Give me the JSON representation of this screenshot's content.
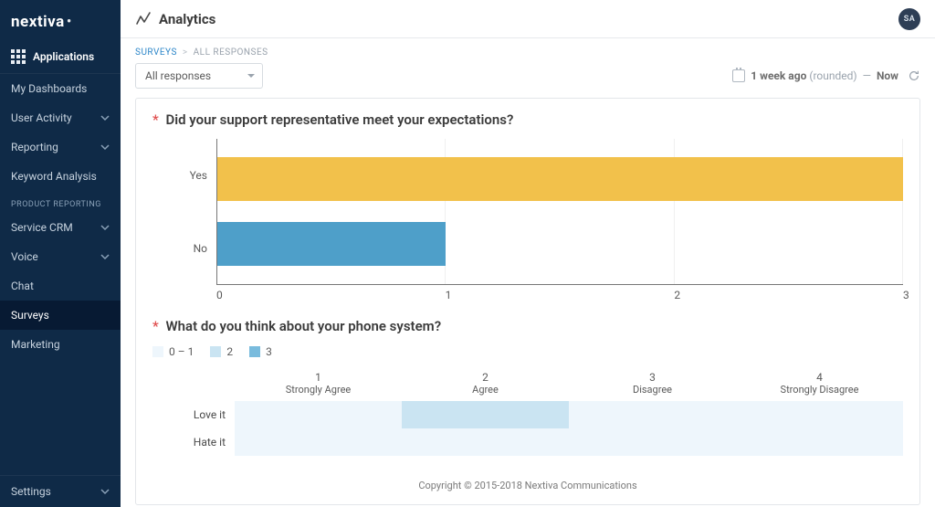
{
  "brand": {
    "name": "nextiva"
  },
  "avatar": {
    "initials": "SA"
  },
  "page": {
    "title": "Analytics",
    "breadcrumb": {
      "root": "SURVEYS",
      "leaf": "ALL RESPONSES"
    }
  },
  "sidebar": {
    "apps_label": "Applications",
    "sections": {
      "top": [
        {
          "label": "My Dashboards",
          "expandable": false
        },
        {
          "label": "User Activity",
          "expandable": true
        },
        {
          "label": "Reporting",
          "expandable": true
        },
        {
          "label": "Keyword Analysis",
          "expandable": false
        }
      ],
      "product_header": "PRODUCT REPORTING",
      "product": [
        {
          "label": "Service CRM",
          "expandable": true
        },
        {
          "label": "Voice",
          "expandable": true
        },
        {
          "label": "Chat",
          "expandable": false
        },
        {
          "label": "Surveys",
          "expandable": false,
          "active": true
        },
        {
          "label": "Marketing",
          "expandable": false
        }
      ]
    },
    "settings_label": "Settings"
  },
  "filters": {
    "dropdown_value": "All responses",
    "range_from": "1 week ago",
    "range_from_suffix": "(rounded)",
    "range_sep": "—",
    "range_to": "Now"
  },
  "questions": [
    {
      "required": true,
      "text": "Did your support representative meet your expectations?",
      "chart": "chart1"
    },
    {
      "required": true,
      "text": "What do you think about your phone system?",
      "chart": "chart2"
    }
  ],
  "legend": {
    "b0": "0 – 1",
    "b1": "2",
    "b2": "3"
  },
  "chart_data": [
    {
      "type": "bar",
      "orientation": "horizontal",
      "title": "Did your support representative meet your expectations?",
      "categories": [
        "Yes",
        "No"
      ],
      "values": [
        3,
        1
      ],
      "xlim": [
        0,
        3
      ],
      "ticks": [
        0,
        1,
        2,
        3
      ],
      "colors": {
        "Yes": "#f2c14b",
        "No": "#4e9fc9"
      }
    },
    {
      "type": "heatmap",
      "title": "What do you think about your phone system?",
      "ycategories": [
        "Love it",
        "Hate it"
      ],
      "xcategories": [
        {
          "num": "1",
          "label": "Strongly Agree"
        },
        {
          "num": "2",
          "label": "Agree"
        },
        {
          "num": "3",
          "label": "Disagree"
        },
        {
          "num": "4",
          "label": "Strongly Disagree"
        }
      ],
      "values": [
        [
          0,
          2,
          0,
          0
        ],
        [
          0,
          0,
          1,
          0
        ]
      ],
      "legend_buckets": [
        {
          "label": "0 – 1",
          "min": 0,
          "max": 1
        },
        {
          "label": "2",
          "min": 2,
          "max": 2
        },
        {
          "label": "3",
          "min": 3,
          "max": 3
        }
      ]
    }
  ],
  "footer": {
    "copyright": "Copyright © 2015-2018 Nextiva Communications"
  }
}
